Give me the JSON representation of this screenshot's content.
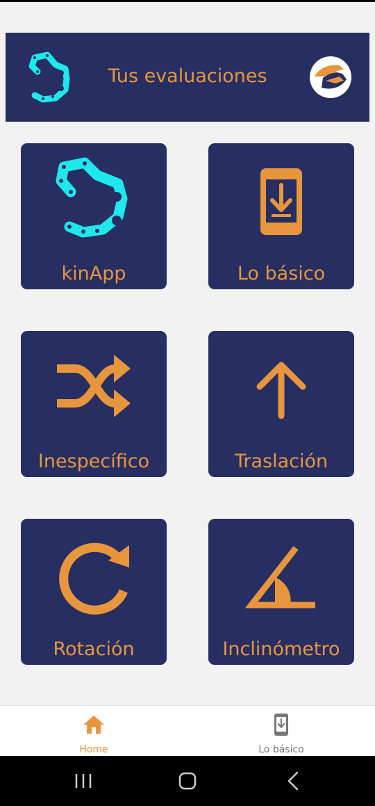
{
  "header": {
    "title": "Tus evaluaciones",
    "logo_icon": "kinapp-chain-logo",
    "right_icon": "hands-logo"
  },
  "tiles": [
    {
      "label": "kinApp",
      "icon": "kinapp-chain-icon"
    },
    {
      "label": "Lo básico",
      "icon": "phone-download-icon"
    },
    {
      "label": "Inespecífico",
      "icon": "shuffle-icon"
    },
    {
      "label": "Traslación",
      "icon": "arrow-up-icon"
    },
    {
      "label": "Rotación",
      "icon": "rotate-icon"
    },
    {
      "label": "Inclinómetro",
      "icon": "angle-icon"
    }
  ],
  "bottom_nav": {
    "items": [
      {
        "label": "Home",
        "icon": "home-icon",
        "active": true
      },
      {
        "label": "Lo básico",
        "icon": "phone-download-icon",
        "active": false
      }
    ]
  },
  "colors": {
    "primary": "#262e62",
    "accent": "#e8963e",
    "cyan": "#1fe8ec",
    "background": "#f2f2f3"
  }
}
